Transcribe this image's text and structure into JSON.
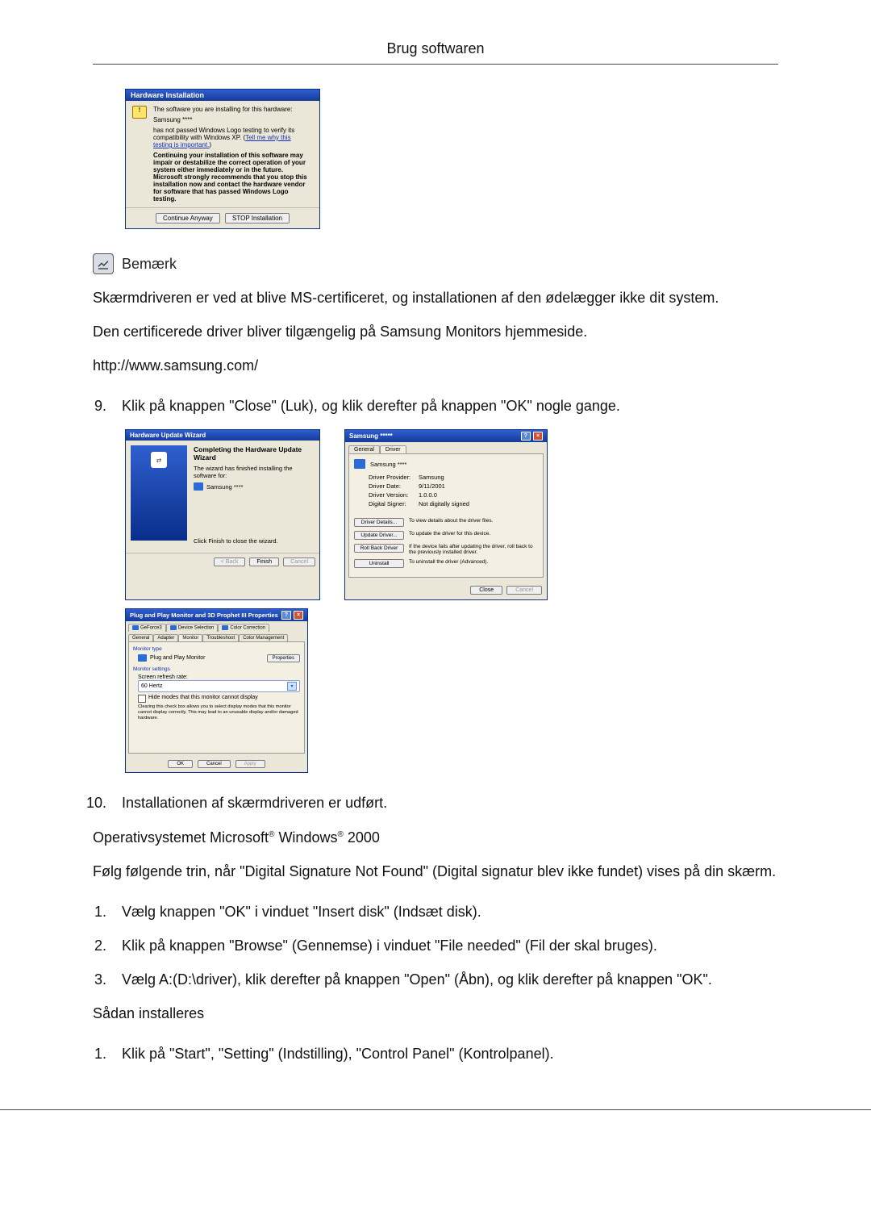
{
  "header": {
    "title": "Brug softwaren"
  },
  "dlg1": {
    "title": "Hardware Installation",
    "line_intro": "The software you are installing for this hardware:",
    "device": "Samsung ****",
    "line_logo": "has not passed Windows Logo testing to verify its compatibility with Windows XP. (",
    "link_text": "Tell me why this testing is important.",
    "line_logo_end": ")",
    "warn": "Continuing your installation of this software may impair or destabilize the correct operation of your system either immediately or in the future. Microsoft strongly recommends that you stop this installation now and contact the hardware vendor for software that has passed Windows Logo testing.",
    "btn_continue": "Continue Anyway",
    "btn_stop": "STOP Installation"
  },
  "note": {
    "label": "Bemærk"
  },
  "body": {
    "p1": "Skærmdriveren er ved at blive MS-certificeret, og installationen af den ødelægger ikke dit system.",
    "p2": "Den certificerede driver bliver tilgængelig på Samsung Monitors hjemmeside.",
    "p3": "http://www.samsung.com/"
  },
  "step9": "Klik på knappen \"Close\" (Luk), og klik derefter på knappen \"OK\" nogle gange.",
  "dlg2": {
    "title": "Hardware Update Wizard",
    "heading": "Completing the Hardware Update Wizard",
    "line1": "The wizard has finished installing the software for:",
    "device": "Samsung ****",
    "line_close": "Click Finish to close the wizard.",
    "btn_back": "< Back",
    "btn_finish": "Finish",
    "btn_cancel": "Cancel"
  },
  "dlg3": {
    "title": "Samsung *****",
    "tab_general": "General",
    "tab_driver": "Driver",
    "device": "Samsung ****",
    "rows": {
      "provider_k": "Driver Provider:",
      "provider_v": "Samsung",
      "date_k": "Driver Date:",
      "date_v": "9/11/2001",
      "version_k": "Driver Version:",
      "version_v": "1.0.0.0",
      "signer_k": "Digital Signer:",
      "signer_v": "Not digitally signed"
    },
    "btns": {
      "details": "Driver Details...",
      "details_d": "To view details about the driver files.",
      "update": "Update Driver...",
      "update_d": "To update the driver for this device.",
      "rollback": "Roll Back Driver",
      "rollback_d": "If the device fails after updating the driver, roll back to the previously installed driver.",
      "uninstall": "Uninstall",
      "uninstall_d": "To uninstall the driver (Advanced)."
    },
    "btn_close": "Close",
    "btn_cancel": "Cancel"
  },
  "dlg4": {
    "title": "Plug and Play Monitor and 3D Prophet III Properties",
    "tabs": {
      "geforce": "GeForce3",
      "devsel": "Device Selection",
      "colorcorr": "Color Correction",
      "general": "General",
      "adapter": "Adapter",
      "monitor": "Monitor",
      "troubleshoot": "Troubleshoot",
      "colormgmt": "Color Management"
    },
    "grp_monitor_type": "Monitor type",
    "monitor_name": "Plug and Play Monitor",
    "btn_properties": "Properties",
    "grp_monitor_settings": "Monitor settings",
    "lbl_refresh": "Screen refresh rate:",
    "sel_refresh": "60 Hertz",
    "chk_hide": "Hide modes that this monitor cannot display",
    "chk_desc": "Clearing this check box allows you to select display modes that this monitor cannot display correctly. This may lead to an unusable display and/or damaged hardware.",
    "btn_ok": "OK",
    "btn_cancel": "Cancel",
    "btn_apply": "Apply"
  },
  "step10": "Installationen af skærmdriveren er udført.",
  "os2000": {
    "prefix": "Operativsystemet Microsoft",
    "mid": " Windows",
    "suffix": " 2000"
  },
  "p_follow": "Følg følgende trin, når \"Digital Signature Not Found\" (Digital signatur blev ikke fundet) vises på din skærm.",
  "list2": {
    "i1": "Vælg knappen \"OK\" i vinduet \"Insert disk\" (Indsæt disk).",
    "i2": "Klik på knappen \"Browse\" (Gennemse) i vinduet \"File needed\" (Fil der skal bruges).",
    "i3": "Vælg A:(D:\\driver), klik derefter på knappen \"Open\" (Åbn), og klik derefter på knappen \"OK\"."
  },
  "h_install": "Sådan installeres",
  "list3": {
    "i1": "Klik på \"Start\", \"Setting\" (Indstilling), \"Control Panel\" (Kontrolpanel)."
  }
}
